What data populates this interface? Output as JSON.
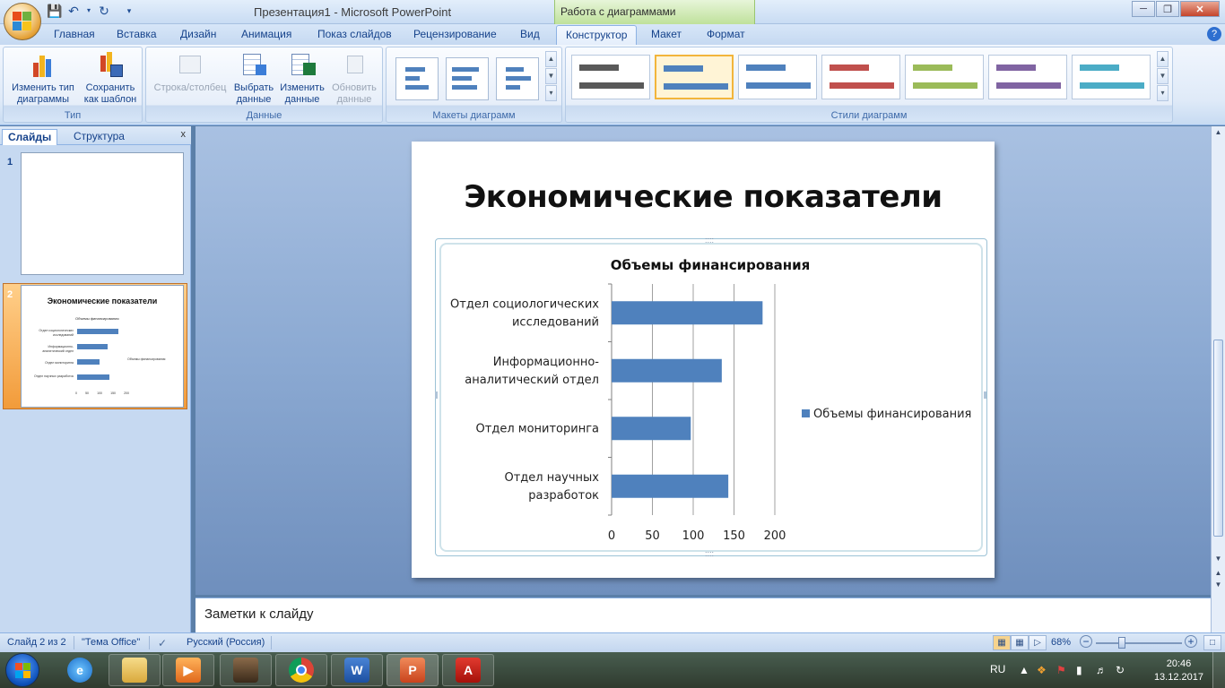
{
  "window": {
    "title": "Презентация1 - Microsoft PowerPoint",
    "context_tab_group": "Работа с диаграммами"
  },
  "tabs": [
    "Главная",
    "Вставка",
    "Дизайн",
    "Анимация",
    "Показ слайдов",
    "Рецензирование",
    "Вид",
    "Конструктор",
    "Макет",
    "Формат"
  ],
  "active_tab": "Конструктор",
  "ribbon": {
    "type_group": {
      "label": "Тип",
      "change_type": "Изменить тип диаграммы",
      "save_template": "Сохранить как шаблон"
    },
    "data_group": {
      "label": "Данные",
      "switch_row_col": "Строка/столбец",
      "select_data": "Выбрать данные",
      "edit_data": "Изменить данные",
      "refresh_data": "Обновить данные"
    },
    "layouts_group": {
      "label": "Макеты диаграмм"
    },
    "styles_group": {
      "label": "Стили диаграмм",
      "style_colors": [
        "#595959",
        "#4f81bd",
        "#4f81bd",
        "#c0504d",
        "#9bbb59",
        "#8064a2",
        "#4bacc6"
      ],
      "selected_index": 1
    }
  },
  "left_pane": {
    "tab_slides": "Слайды",
    "tab_outline": "Структура",
    "close": "x",
    "slides": [
      {
        "number": "1"
      },
      {
        "number": "2",
        "title": "Экономические показатели",
        "chart_title": "Объемы финансирования",
        "categories": [
          "Отдел социологических исследований",
          "Информационно-аналитический отдел",
          "Отдел мониторинга",
          "Отдел научных разработок"
        ],
        "legend": "Объемы финансирования",
        "ticks": [
          "0",
          "50",
          "100",
          "150",
          "200"
        ]
      }
    ]
  },
  "slide": {
    "title": "Экономические показатели"
  },
  "chart_data": {
    "type": "bar",
    "orientation": "horizontal",
    "title": "Объемы финансирования",
    "categories": [
      "Отдел социологических исследований",
      "Информационно-аналитический отдел",
      "Отдел мониторинга",
      "Отдел научных разработок"
    ],
    "category_lines": [
      [
        "Отдел социологических",
        "исследований"
      ],
      [
        "Информационно-",
        "аналитический отдел"
      ],
      [
        "Отдел мониторинга"
      ],
      [
        "Отдел научных",
        "разработок"
      ]
    ],
    "series": [
      {
        "name": "Объемы финансирования",
        "values": [
          185,
          135,
          97,
          143
        ],
        "color": "#4f81bd"
      }
    ],
    "xlim": [
      0,
      200
    ],
    "xticks": [
      "0",
      "50",
      "100",
      "150",
      "200"
    ],
    "grid": true,
    "legend_position": "right"
  },
  "notes": {
    "placeholder": "Заметки к слайду"
  },
  "status": {
    "slide_info": "Слайд 2 из 2",
    "theme": "\"Тема Office\"",
    "language": "Русский (Россия)",
    "zoom": "68%",
    "zoom_minus": "−",
    "zoom_plus": "+"
  },
  "taskbar": {
    "language": "RU",
    "time": "20:46",
    "date": "13.12.2017"
  }
}
